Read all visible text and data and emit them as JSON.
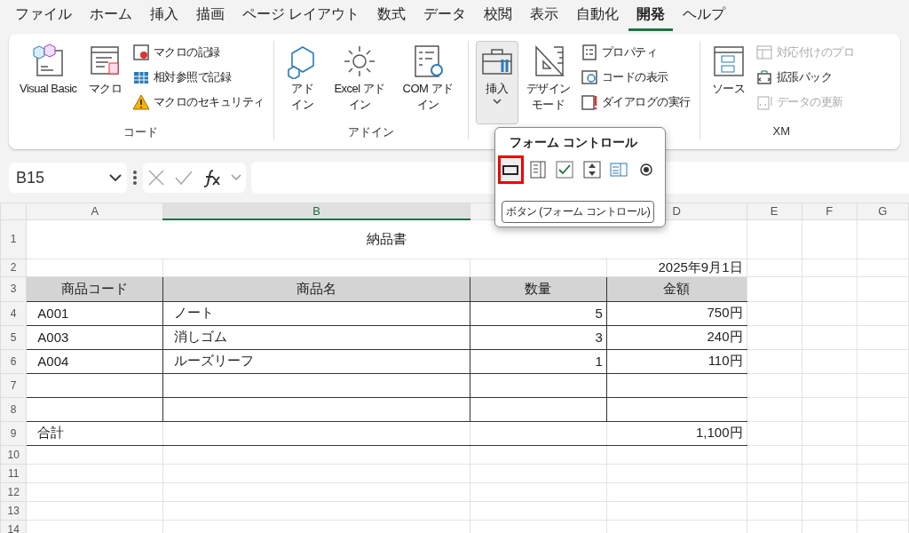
{
  "menu_tabs": [
    {
      "label": "ファイル",
      "selected": false
    },
    {
      "label": "ホーム",
      "selected": false
    },
    {
      "label": "挿入",
      "selected": false
    },
    {
      "label": "描画",
      "selected": false
    },
    {
      "label": "ページ レイアウト",
      "selected": false
    },
    {
      "label": "数式",
      "selected": false
    },
    {
      "label": "データ",
      "selected": false
    },
    {
      "label": "校閲",
      "selected": false
    },
    {
      "label": "表示",
      "selected": false
    },
    {
      "label": "自動化",
      "selected": false
    },
    {
      "label": "開発",
      "selected": true
    },
    {
      "label": "ヘルプ",
      "selected": false
    }
  ],
  "ribbon_groups": [
    {
      "kind": "code",
      "label": "コード",
      "large": [
        {
          "label": "Visual Basic",
          "pressed": false
        },
        {
          "label": "マクロ",
          "pressed": false
        }
      ],
      "small": [
        {
          "label": "マクロの記録",
          "disabled": false
        },
        {
          "label": "相対参照で記録",
          "disabled": false
        },
        {
          "label": "マクロのセキュリティ",
          "disabled": false
        }
      ]
    },
    {
      "kind": "addins",
      "label": "アドイン",
      "large": [
        {
          "label": "アドイン",
          "pressed": false
        },
        {
          "label": "Excel アドイン",
          "pressed": false
        },
        {
          "label": "COM アドイン",
          "pressed": false
        }
      ]
    },
    {
      "kind": "controls",
      "large": [
        {
          "label": "挿入",
          "pressed": true
        },
        {
          "label": "デザインモード",
          "pressed": false
        }
      ],
      "small": [
        {
          "label": "プロパティ",
          "disabled": false
        },
        {
          "label": "コードの表示",
          "disabled": false
        },
        {
          "label": "ダイアログの実行",
          "disabled": false
        }
      ]
    },
    {
      "kind": "xml",
      "label": "XM",
      "large": [
        {
          "label": "ソース",
          "pressed": false
        }
      ],
      "small": [
        {
          "label": "対応付けのプロ",
          "disabled": true
        },
        {
          "label": "拡張パック",
          "disabled": false
        },
        {
          "label": "データの更新",
          "disabled": true
        }
      ]
    }
  ],
  "formula_bar": {
    "name_box": "B15"
  },
  "columns": [
    {
      "label": "A",
      "selected": false
    },
    {
      "label": "B",
      "selected": true
    },
    {
      "selected": false
    },
    {
      "label": "D",
      "selected": false
    },
    {
      "label": "E",
      "selected": false
    },
    {
      "label": "F",
      "selected": false
    },
    {
      "label": "G",
      "selected": false
    }
  ],
  "row_numbers": [
    "1",
    "2",
    "3",
    "4",
    "5",
    "6",
    "7",
    "8",
    "9",
    "10",
    "11",
    "12",
    "13",
    "14"
  ],
  "sheet": {
    "title": "納品書",
    "date": "2025年9月1日",
    "headers": [
      "商品コード",
      "商品名",
      "数量",
      "金額"
    ],
    "items": [
      {
        "code": "A001",
        "name": "ノート",
        "qty": "5",
        "amount": "750円"
      },
      {
        "code": "A003",
        "name": "消しゴム",
        "qty": "3",
        "amount": "240円"
      },
      {
        "code": "A004",
        "name": "ルーズリーフ",
        "qty": "1",
        "amount": "110円"
      }
    ],
    "total_label": "合計",
    "total": "1,100円"
  },
  "form_controls_popup": {
    "title": "フォーム コントロール",
    "controls": [
      {
        "selected": true
      },
      {
        "selected": false
      },
      {
        "selected": false
      },
      {
        "selected": false
      },
      {
        "selected": false
      },
      {
        "selected": false
      }
    ],
    "tooltip": "ボタン (フォーム コントロール)"
  }
}
